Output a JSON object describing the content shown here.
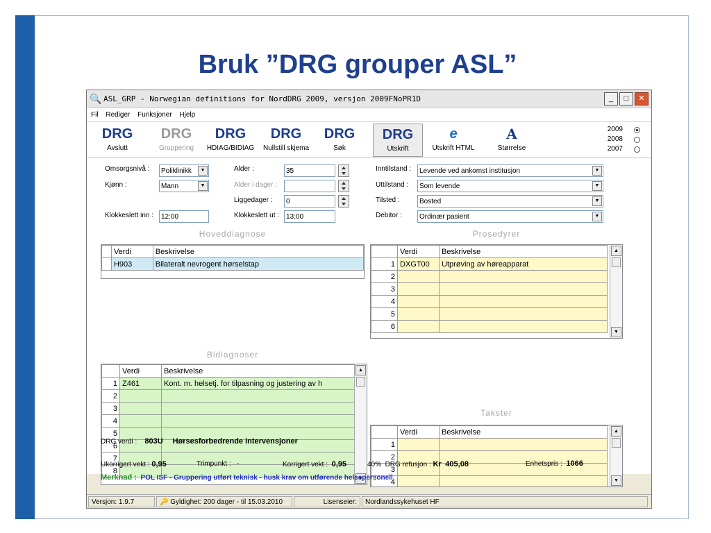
{
  "slide": {
    "title": "Bruk ”DRG grouper ASL”",
    "footer_char": "r"
  },
  "window": {
    "title": "ASL_GRP - Norwegian definitions for NordDRG 2009, versjon 2009FNoPR1D",
    "min": "_",
    "max": "□",
    "close": "✕"
  },
  "menu": [
    "Fil",
    "Rediger",
    "Funksjoner",
    "Hjelp"
  ],
  "toolbar": {
    "avslutt": {
      "icon": "DRG",
      "label": "Avslutt"
    },
    "gruppering": {
      "icon": "DRG",
      "label": "Gruppering"
    },
    "hdiag": {
      "icon": "DRG",
      "label": "HDIAG/BIDIAG"
    },
    "nullstill": {
      "icon": "DRG",
      "label": "Nullstill skjema"
    },
    "sok": {
      "icon": "DRG",
      "label": "Søk"
    },
    "utskrift": {
      "icon": "DRG",
      "label": "Utskrift"
    },
    "utskrift_html": {
      "icon": "e",
      "label": "Utskrift HTML"
    },
    "storrelse": {
      "icon": "A",
      "label": "Størrelse"
    },
    "years": [
      "2009",
      "2008",
      "2007"
    ],
    "year_selected": "2009"
  },
  "form": {
    "omsorgsniva_label": "Omsorgsnivå :",
    "omsorgsniva_value": "Poliklinikk",
    "kjonn_label": "Kjønn :",
    "kjonn_value": "Mann",
    "klokkeslett_inn_label": "Klokkeslett inn :",
    "klokkeslett_inn_value": "12:00",
    "alder_label": "Alder :",
    "alder_value": "35",
    "alder_dager_label": "Alder i dager :",
    "alder_dager_value": "",
    "liggedager_label": "Liggedager :",
    "liggedager_value": "0",
    "klokkeslett_ut_label": "Klokkeslett ut :",
    "klokkeslett_ut_value": "13:00",
    "inntilstand_label": "Inntilstand :",
    "inntilstand_value": "Levende ved ankomst institusjon",
    "uttilstand_label": "Uttilstand :",
    "uttilstand_value": "Som levende",
    "tilsted_label": "Tilsted :",
    "tilsted_value": "Bosted",
    "debitor_label": "Debitor :",
    "debitor_value": "Ordinær pasient"
  },
  "sections": {
    "hoveddiagnose": "Hoveddiagnose",
    "bidiagnoser": "Bidiagnoser",
    "prosedyrer": "Prosedyrer",
    "takster": "Takster"
  },
  "grid_headers": {
    "verdi": "Verdi",
    "beskrivelse": "Beskrivelse"
  },
  "hoveddiagnose_rows": [
    {
      "verdi": "H903",
      "beskrivelse": "Bilateralt nevrogent hørselstap"
    }
  ],
  "bidiagnoser_rows": [
    {
      "n": "1",
      "verdi": "Z461",
      "beskrivelse": "Kont. m. helsetj. for tilpasning og justering av h"
    },
    {
      "n": "2",
      "verdi": "",
      "beskrivelse": ""
    },
    {
      "n": "3",
      "verdi": "",
      "beskrivelse": ""
    },
    {
      "n": "4",
      "verdi": "",
      "beskrivelse": ""
    },
    {
      "n": "5",
      "verdi": "",
      "beskrivelse": ""
    },
    {
      "n": "6",
      "verdi": "",
      "beskrivelse": ""
    },
    {
      "n": "7",
      "verdi": "",
      "beskrivelse": ""
    },
    {
      "n": "8",
      "verdi": "",
      "beskrivelse": ""
    }
  ],
  "prosedyrer_rows": [
    {
      "n": "1",
      "verdi": "DXGT00",
      "beskrivelse": "Utprøving av høreapparat"
    },
    {
      "n": "2",
      "verdi": "",
      "beskrivelse": ""
    },
    {
      "n": "3",
      "verdi": "",
      "beskrivelse": ""
    },
    {
      "n": "4",
      "verdi": "",
      "beskrivelse": ""
    },
    {
      "n": "5",
      "verdi": "",
      "beskrivelse": ""
    },
    {
      "n": "6",
      "verdi": "",
      "beskrivelse": ""
    }
  ],
  "takster_rows": [
    {
      "n": "1",
      "verdi": "",
      "beskrivelse": ""
    },
    {
      "n": "2",
      "verdi": "",
      "beskrivelse": ""
    },
    {
      "n": "3",
      "verdi": "",
      "beskrivelse": ""
    },
    {
      "n": "4",
      "verdi": "",
      "beskrivelse": ""
    }
  ],
  "result": {
    "drg_label": "DRG verdi :",
    "drg_value": "803U",
    "drg_text": "Hørsesforbedrende intervensjoner",
    "ukorrigert_label": "Ukorrigert vekt :",
    "ukorrigert_value": "0,95",
    "trimpunkt_label": "Trimpunkt :",
    "trimpunkt_value": "-",
    "korrigert_label": "Korrigert vekt :",
    "korrigert_value": "0,95",
    "refusjon_pct": "40%",
    "refusjon_label": "DRG refusjon :",
    "refusjon_currency": "Kr",
    "refusjon_value": "405,08",
    "enhetspris_label": "Enhetspris :",
    "enhetspris_value": "1066",
    "merknad_label": "Merknad :",
    "merknad_text": "POL ISF - Gruppering utført teknisk - husk krav om utførende helsepersonell"
  },
  "status": {
    "versjon": "Versjon: 1.9.7",
    "gyldighet": "Gyldighet: 200 dager - til 15.03.2010",
    "lisenseier_label": "Lisenseier:",
    "lisenseier_value": "Nordlandssykehuset HF"
  }
}
